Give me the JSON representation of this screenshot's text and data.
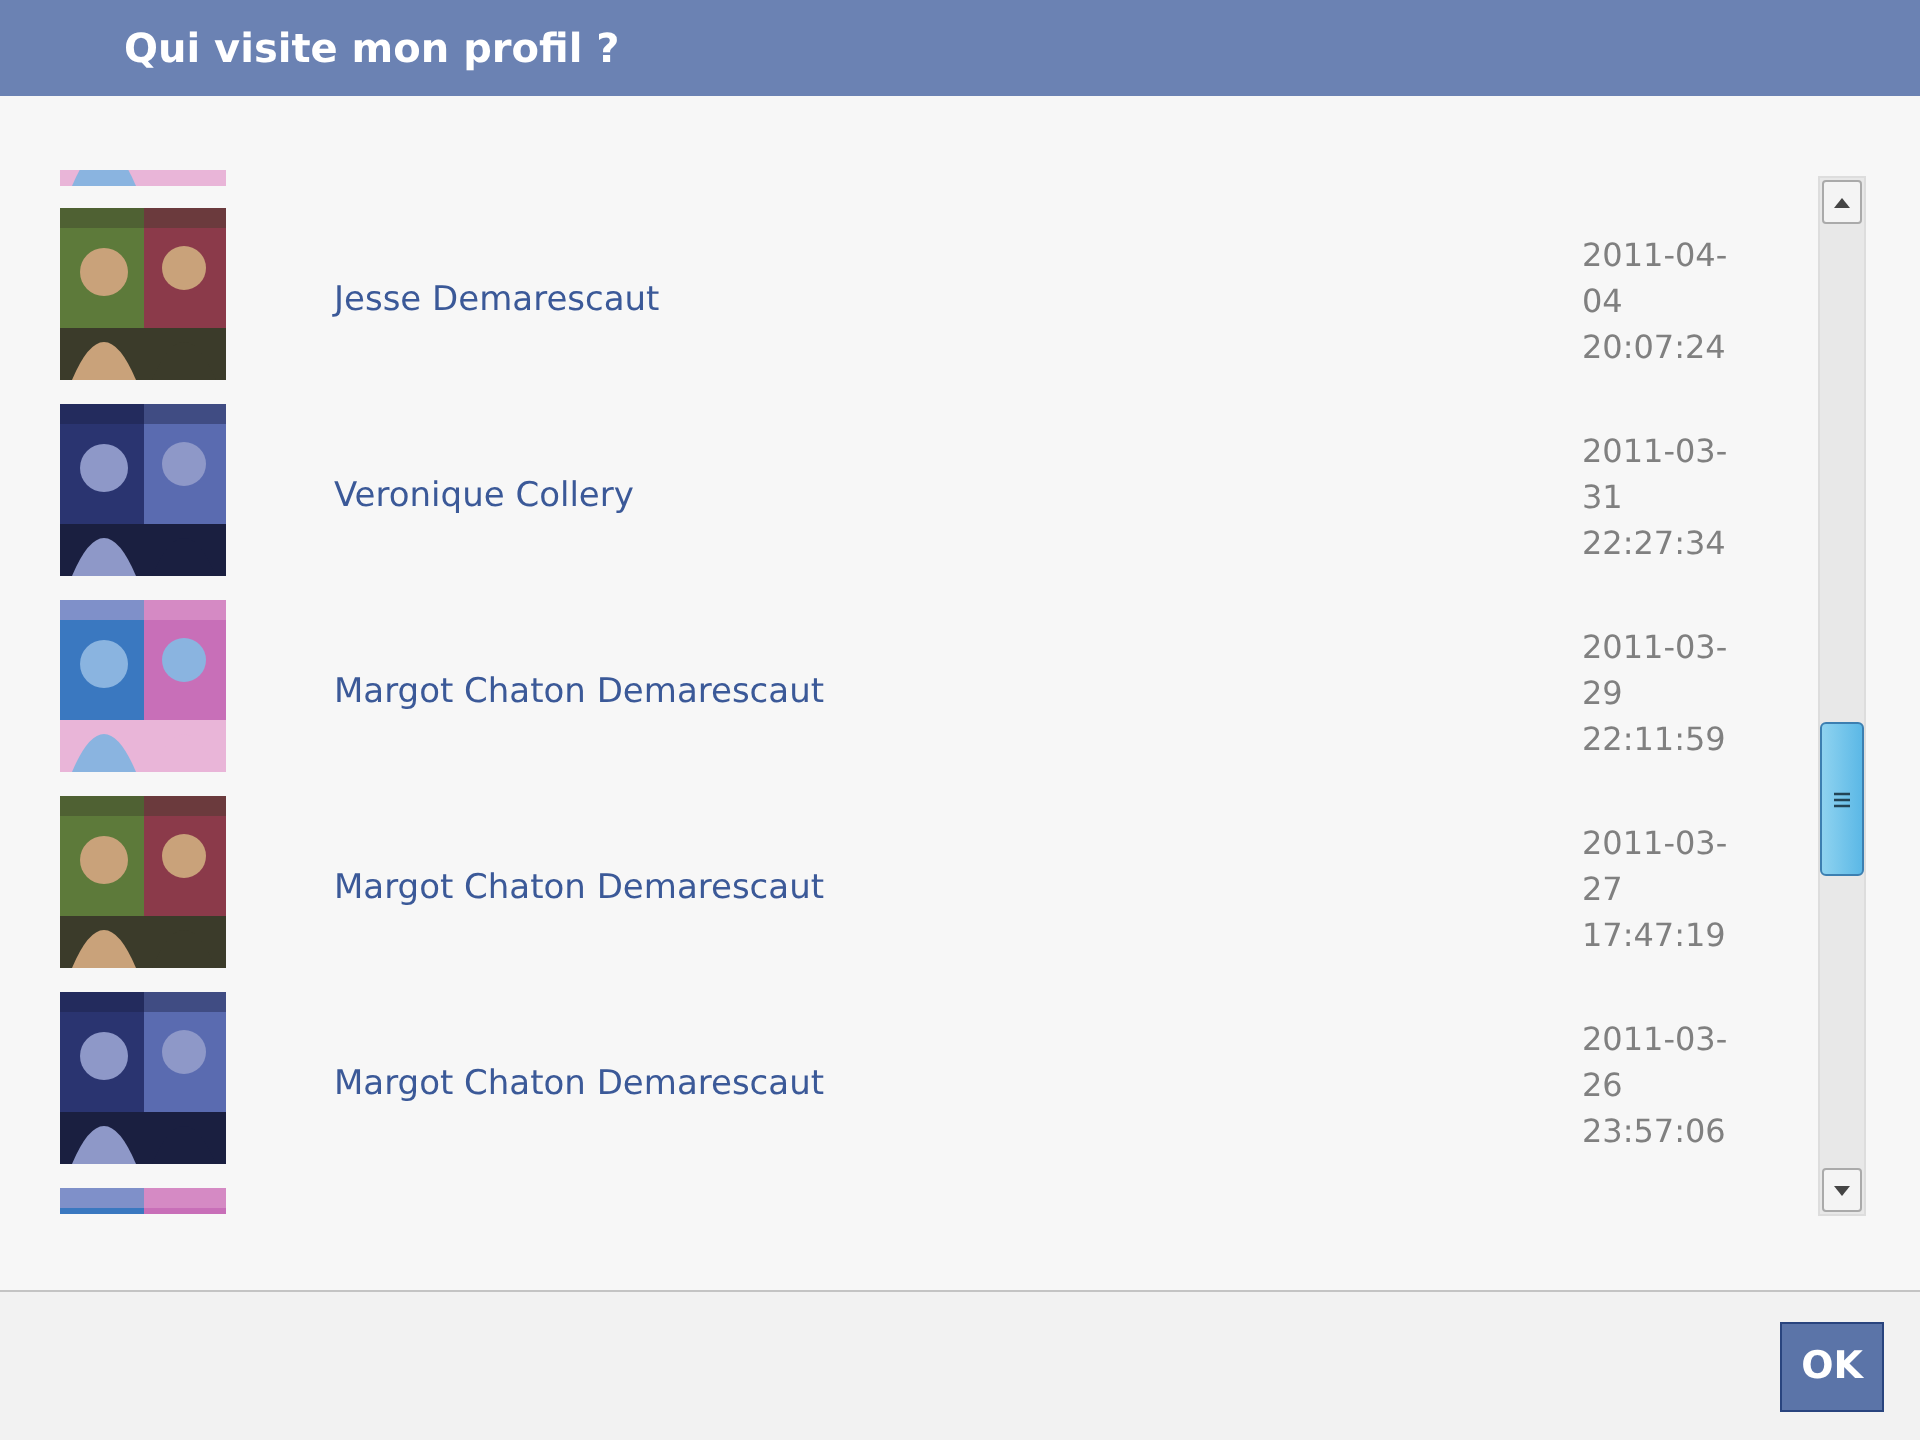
{
  "dialog": {
    "title": "Qui visite mon profil ?"
  },
  "visitors": [
    {
      "kind": "partial"
    },
    {
      "kind": "visitor",
      "name": "Jesse Demarescaut",
      "date": "2011-04-04 20:07:24"
    },
    {
      "kind": "visitor",
      "name": "Veronique Collery",
      "date": "2011-03-31 22:27:34"
    },
    {
      "kind": "visitor",
      "name": "Margot Chaton Demarescaut",
      "date": "2011-03-29 22:11:59"
    },
    {
      "kind": "visitor",
      "name": "Margot Chaton Demarescaut",
      "date": "2011-03-27 17:47:19"
    },
    {
      "kind": "visitor",
      "name": "Margot Chaton Demarescaut",
      "date": "2011-03-26 23:57:06"
    },
    {
      "kind": "partial"
    }
  ],
  "buttons": [
    "OK"
  ]
}
